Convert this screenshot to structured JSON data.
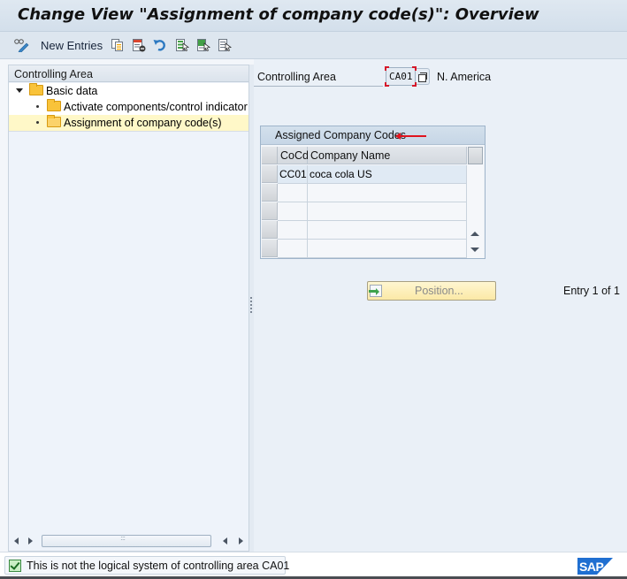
{
  "window": {
    "title": "Change View \"Assignment of company code(s)\": Overview"
  },
  "toolbar": {
    "items": [
      {
        "icon": "display-change-icon",
        "label": ""
      },
      {
        "icon": "new-entries-label",
        "label": "New Entries"
      },
      {
        "icon": "copy-as-icon",
        "label": ""
      },
      {
        "icon": "delete-icon",
        "label": ""
      },
      {
        "icon": "undo-change-icon",
        "label": ""
      },
      {
        "icon": "select-all-icon",
        "label": ""
      },
      {
        "icon": "select-block-icon",
        "label": ""
      },
      {
        "icon": "deselect-all-icon",
        "label": ""
      }
    ]
  },
  "tree": {
    "header": "Controlling Area",
    "nodes": [
      {
        "label": "Basic data",
        "level": 0,
        "expanded": true,
        "icon": "folder-icon"
      },
      {
        "label": "Activate components/control indicator",
        "level": 1,
        "icon": "folder-icon"
      },
      {
        "label": "Assignment of company code(s)",
        "level": 1,
        "icon": "folder-open-icon",
        "selected": true
      }
    ]
  },
  "form": {
    "controlling_area_label": "Controlling Area",
    "controlling_area_value": "CA01",
    "controlling_area_desc": "N. America"
  },
  "table": {
    "title": "Assigned Company Codes",
    "columns": [
      "CoCd",
      "Company Name"
    ],
    "rows": [
      [
        "CC01",
        "coca cola US"
      ],
      [
        "",
        ""
      ],
      [
        "",
        ""
      ],
      [
        "",
        ""
      ],
      [
        "",
        ""
      ]
    ]
  },
  "actions": {
    "position_label": "Position...",
    "entry_info": "Entry 1 of 1"
  },
  "status": {
    "type": "success",
    "message": "This is not the logical system of controlling area CA01"
  },
  "branding": {
    "logo_text": "SAP",
    "logo_color": "#1f6fd1"
  },
  "colors": {
    "selected_row": "#fff8c8",
    "annotation_red": "#e0141e",
    "folder": "#f9c33a"
  }
}
